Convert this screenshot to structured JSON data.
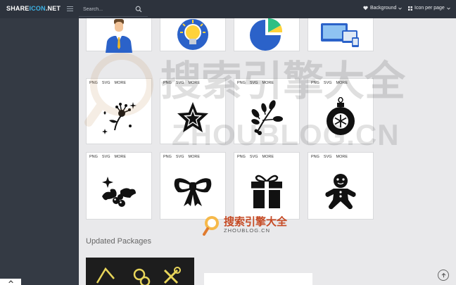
{
  "header": {
    "logo_main": "SHARE",
    "logo_accent": "ICON",
    "logo_suffix": ".NET",
    "search_placeholder": "Search...",
    "background_label": "Background",
    "per_page_label": "Icon per page"
  },
  "card_links": {
    "png": "PNG",
    "svg": "SVG",
    "more": "MORE"
  },
  "icons": [
    {
      "icon": "businessman-icon"
    },
    {
      "icon": "lightbulb-icon"
    },
    {
      "icon": "pie-chart-icon"
    },
    {
      "icon": "devices-icon"
    },
    {
      "icon": "flower-sparkle-icon"
    },
    {
      "icon": "star-icon"
    },
    {
      "icon": "mistletoe-icon"
    },
    {
      "icon": "ornament-icon"
    },
    {
      "icon": "holly-icon"
    },
    {
      "icon": "bow-icon"
    },
    {
      "icon": "gift-icon"
    },
    {
      "icon": "gingerbread-icon"
    }
  ],
  "updated": {
    "title": "Updated Packages"
  },
  "watermark": {
    "cn": "搜索引擎大全",
    "domain": "ZHOUBLOG.CN"
  },
  "colors": {
    "topbar": "#2d333d",
    "sidebar": "#343a44",
    "accent": "#3db3e6"
  }
}
